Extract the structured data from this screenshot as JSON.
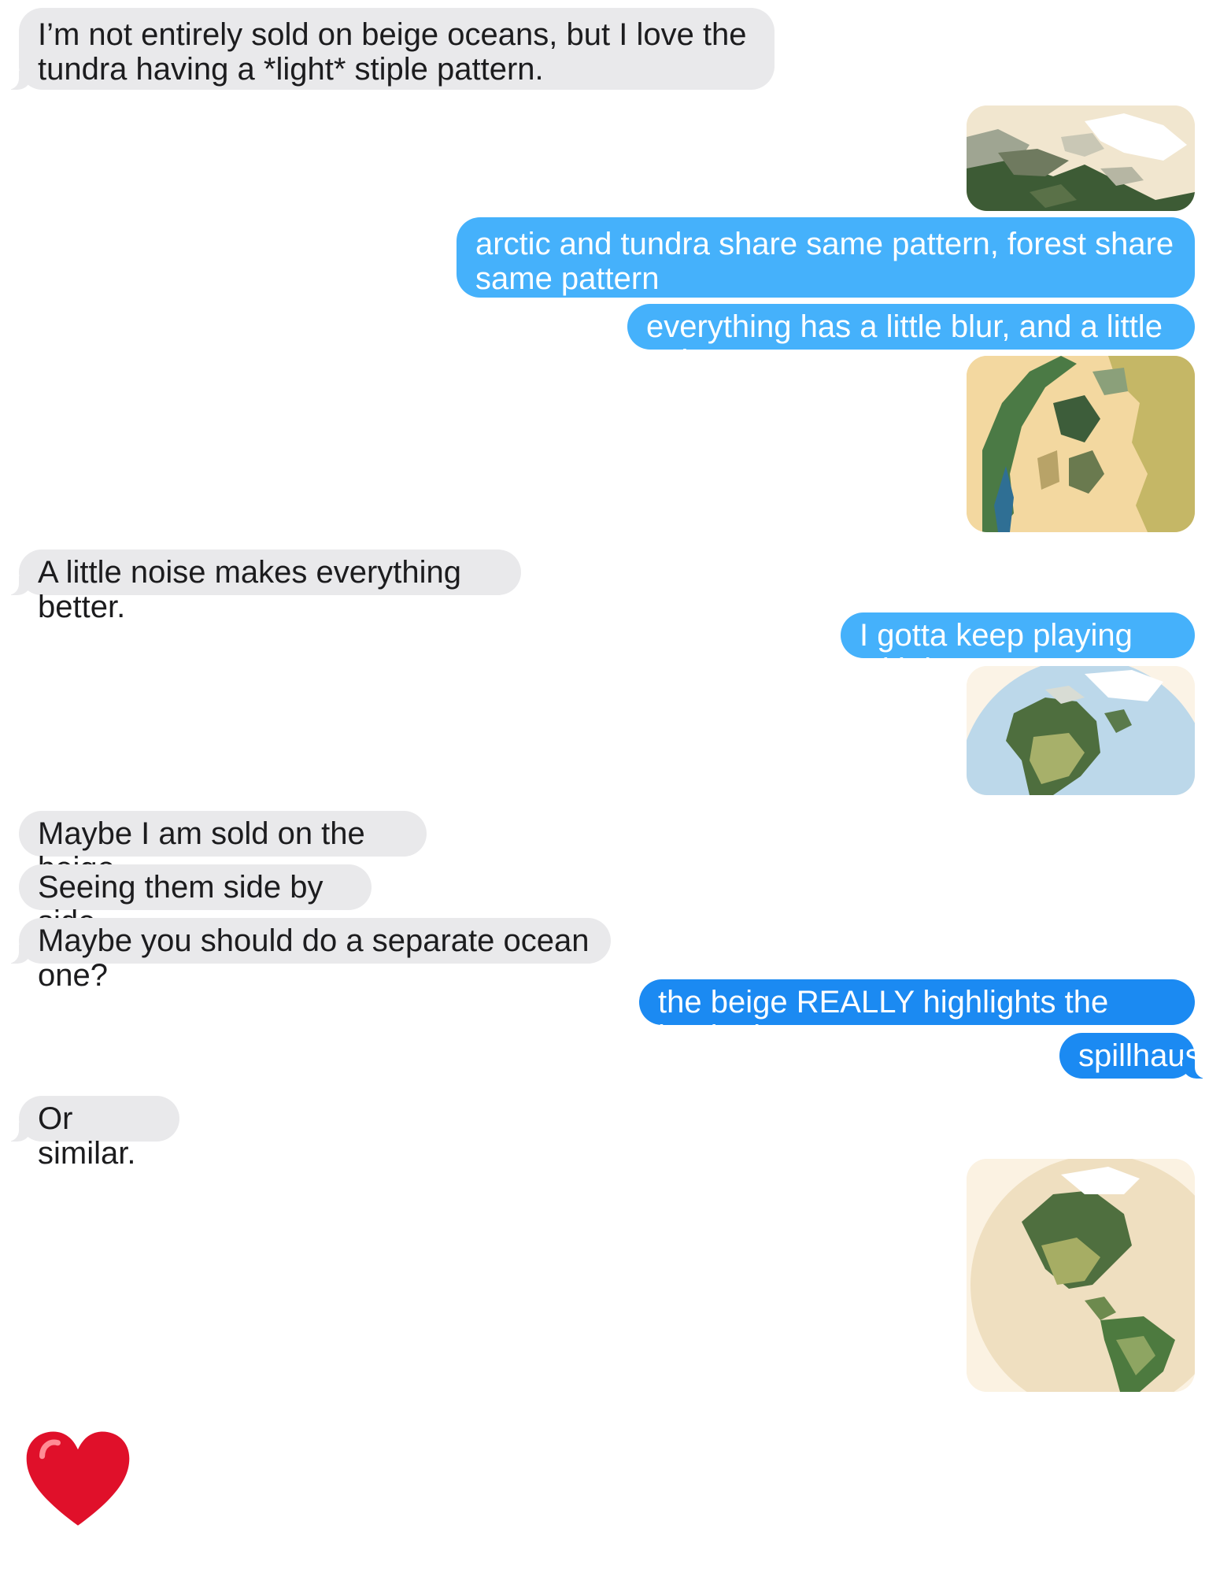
{
  "messages": [
    {
      "from": "them",
      "text": "I’m not entirely sold on beige oceans, but I love the tundra having a *light* stiple pattern."
    },
    {
      "from": "me",
      "type": "image",
      "alt": "arctic-tundra-map"
    },
    {
      "from": "me",
      "text": "arctic and tundra share same pattern, forest share same pattern"
    },
    {
      "from": "me",
      "text": "everything has a little blur, and a little noise"
    },
    {
      "from": "me",
      "type": "image",
      "alt": "beige-relief-map"
    },
    {
      "from": "them",
      "text": "A little noise makes everything better."
    },
    {
      "from": "me",
      "text": "I gotta keep playing with it"
    },
    {
      "from": "me",
      "type": "image",
      "alt": "blue-ocean-globe"
    },
    {
      "from": "them",
      "text": "Maybe I am sold on the beige."
    },
    {
      "from": "them",
      "text": "Seeing them side by side."
    },
    {
      "from": "them",
      "text": "Maybe you should do a separate ocean one?"
    },
    {
      "from": "me",
      "text": "the beige REALLY highlights the land + ice"
    },
    {
      "from": "me",
      "text": "spillhaus"
    },
    {
      "from": "them",
      "text": "Or similar."
    },
    {
      "from": "me",
      "type": "image",
      "alt": "beige-globe-americas"
    },
    {
      "from": "them",
      "type": "emoji",
      "alt": "red-heart"
    }
  ],
  "colors": {
    "incoming_bubble": "#e9e9eb",
    "outgoing_bubble_light": "#45b1fb",
    "outgoing_bubble_dark": "#1b8af2",
    "heart": "#e0102a"
  }
}
